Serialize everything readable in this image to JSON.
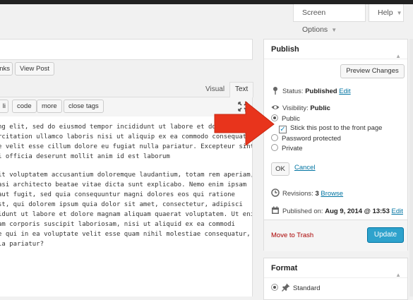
{
  "header": {
    "screen_options": "Screen Options",
    "help": "Help"
  },
  "editor": {
    "permalink_buttons": {
      "links_partial": "nks",
      "view_post": "View Post"
    },
    "tabs": {
      "visual": "Visual",
      "text": "Text"
    },
    "quicktags": {
      "li": "li",
      "code": "code",
      "more": "more",
      "close_tags": "close tags"
    },
    "lines": [
      "ng elit, sed do eiusmod tempor incididunt ut labore et dolor",
      "rcitation ullamco laboris nisi ut aliquip ex ea commodo consequat.",
      "e velit esse cillum dolore eu fugiat nulla pariatur. Excepteur sint",
      "i officia deserunt mollit anim id est laborum",
      "",
      "it voluptatem accusantium doloremque laudantium, totam rem aperiam,",
      "asi architecto beatae vitae dicta sunt explicabo. Nemo enim ipsam",
      "aut fugit, sed quia consequuntur magni dolores eos qui ratione",
      "st, qui dolorem ipsum quia dolor sit amet, consectetur, adipisci",
      "idunt ut labore et dolore magnam aliquam quaerat voluptatem. Ut enim",
      "am corporis suscipit laboriosam, nisi ut aliquid ex ea commodi",
      "e qui in ea voluptate velit esse quam nihil molestiae consequatur,",
      "la pariatur?"
    ]
  },
  "publish": {
    "title": "Publish",
    "preview_button": "Preview Changes",
    "status_label": "Status:",
    "status_value": "Published",
    "status_edit": "Edit",
    "visibility_label": "Visibility:",
    "visibility_value": "Public",
    "options": {
      "public": "Public",
      "sticky": "Stick this post to the front page",
      "password": "Password protected",
      "private": "Private"
    },
    "ok_button": "OK",
    "cancel_link": "Cancel",
    "revisions_label": "Revisions:",
    "revisions_count": "3",
    "revisions_browse": "Browse",
    "published_label": "Published on:",
    "published_date": "Aug 9, 2014 @ 13:53",
    "published_edit": "Edit",
    "trash_link": "Move to Trash",
    "update_button": "Update"
  },
  "format": {
    "title": "Format",
    "standard": "Standard"
  },
  "colors": {
    "accent": "#2ea2cc",
    "link": "#0074a2",
    "trash": "#a00000",
    "arrow": "#e8341c"
  }
}
